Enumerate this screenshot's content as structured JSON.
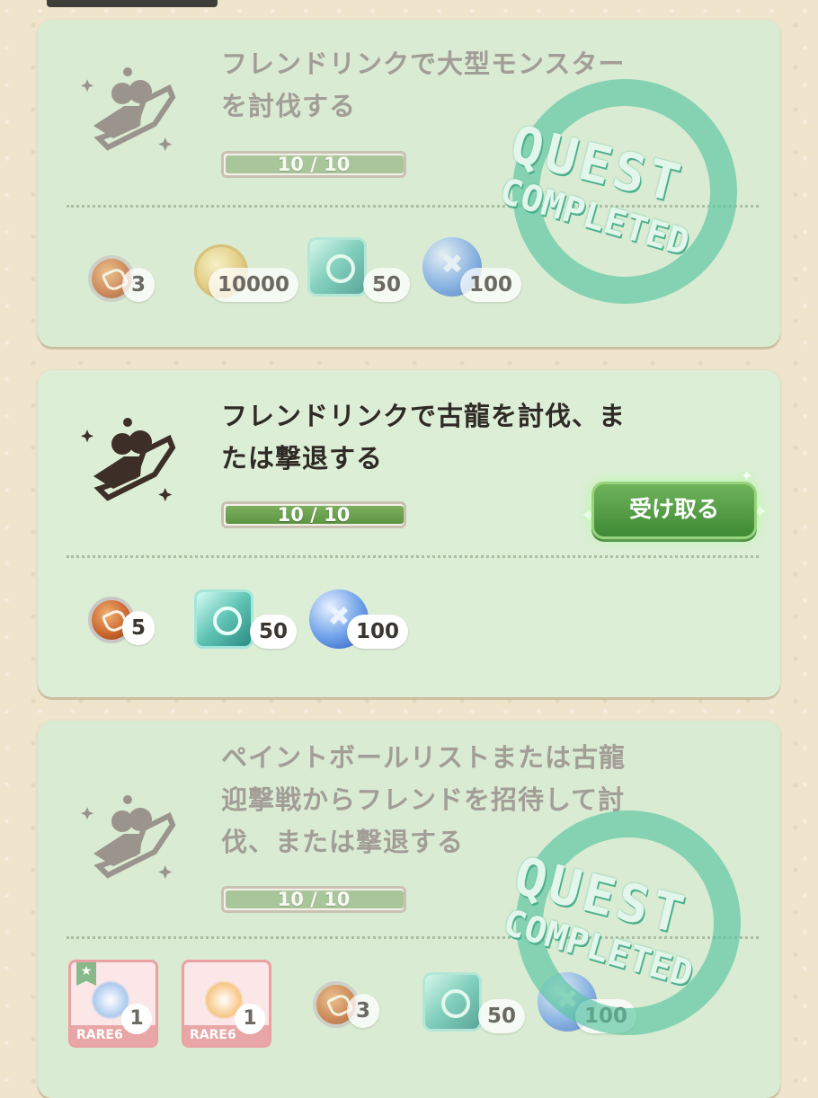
{
  "quests": [
    {
      "title_line1": "フレンドリンクで大型モンスター",
      "title_line2": "を討伐する",
      "progress": "10 / 10",
      "progress_fraction": 1.0,
      "completed_stamp": true,
      "rewards": [
        {
          "icon": "medal-icon",
          "count": "3"
        },
        {
          "icon": "zenny-coin-icon",
          "count": "10000"
        },
        {
          "icon": "armor-sphere-gem-icon",
          "count": "50"
        },
        {
          "icon": "blue-orb-icon",
          "count": "100"
        }
      ]
    },
    {
      "title_line1": "フレンドリンクで古龍を討伐、ま",
      "title_line2": "たは撃退する",
      "progress": "10 / 10",
      "progress_fraction": 1.0,
      "completed_stamp": false,
      "claim_label": "受け取る",
      "rewards": [
        {
          "icon": "medal-icon",
          "count": "5"
        },
        {
          "icon": "armor-sphere-gem-icon",
          "count": "50"
        },
        {
          "icon": "blue-orb-icon",
          "count": "100"
        }
      ]
    },
    {
      "title_line1": "ペイントボールリストまたは古龍",
      "title_line2": "迎撃戦からフレンドを招待して討",
      "title_line3": "伐、または撃退する",
      "progress": "10 / 10",
      "progress_fraction": 1.0,
      "completed_stamp": true,
      "rewards": [
        {
          "icon": "rare6-ticket-blue",
          "label": "RARE6",
          "count": "1"
        },
        {
          "icon": "rare6-ticket-orange",
          "label": "RARE6",
          "count": "1"
        },
        {
          "icon": "medal-icon",
          "count": "3"
        },
        {
          "icon": "armor-sphere-gem-icon",
          "count": "50"
        },
        {
          "icon": "blue-orb-icon",
          "count": "100"
        }
      ]
    }
  ],
  "stamp": {
    "line1": "QUEST",
    "line2": "COMPLETED"
  },
  "colors": {
    "card_bg": "#ddeed7",
    "progress_fill": "#5c9641",
    "claim_button": "#4f9a3f",
    "stamp": "#56c4a0"
  }
}
